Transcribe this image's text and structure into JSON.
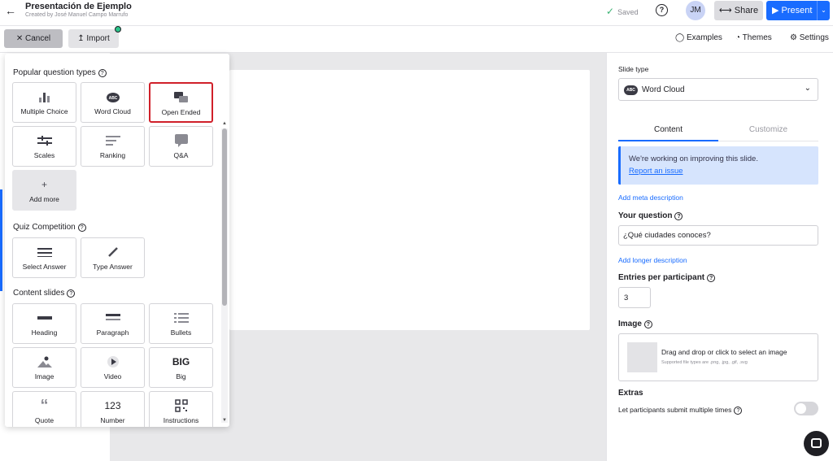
{
  "header": {
    "back_icon": "arrow-left-icon",
    "title": "Presentación de Ejemplo",
    "subtitle": "Created by José Manuel Campo Marrufo",
    "saved_label": "Saved",
    "avatar_initials": "JM",
    "share_label": "Share",
    "present_label": "Present"
  },
  "toolbar": {
    "cancel_label": "Cancel",
    "import_label": "Import",
    "examples_label": "Examples",
    "themes_label": "Themes",
    "settings_label": "Settings"
  },
  "panel": {
    "popular_title": "Popular question types",
    "popular": [
      {
        "label": "Multiple Choice",
        "icon": "bar-chart-icon"
      },
      {
        "label": "Word Cloud",
        "icon": "word-cloud-icon"
      },
      {
        "label": "Open Ended",
        "icon": "speech-bubbles-icon"
      },
      {
        "label": "Scales",
        "icon": "sliders-icon"
      },
      {
        "label": "Ranking",
        "icon": "ranking-icon"
      },
      {
        "label": "Q&A",
        "icon": "qa-bubble-icon"
      },
      {
        "label": "Add more",
        "icon": "plus-icon"
      }
    ],
    "quiz_title": "Quiz Competition",
    "quiz": [
      {
        "label": "Select Answer",
        "icon": "list-lines-icon"
      },
      {
        "label": "Type Answer",
        "icon": "pencil-icon"
      }
    ],
    "content_title": "Content slides",
    "content": [
      {
        "label": "Heading",
        "icon": "heading-icon"
      },
      {
        "label": "Paragraph",
        "icon": "paragraph-icon"
      },
      {
        "label": "Bullets",
        "icon": "bullets-icon"
      },
      {
        "label": "Image",
        "icon": "image-icon"
      },
      {
        "label": "Video",
        "icon": "play-icon"
      },
      {
        "label": "Big",
        "icon": "big-text-icon",
        "glyph": "BIG"
      },
      {
        "label": "Quote",
        "icon": "quote-icon"
      },
      {
        "label": "Number",
        "icon": "number-icon",
        "glyph": "123"
      },
      {
        "label": "Instructions",
        "icon": "qr-code-icon"
      }
    ]
  },
  "right": {
    "slide_type_label": "Slide type",
    "slide_type_value": "Word Cloud",
    "slide_type_icon_text": "ABC",
    "tab_content": "Content",
    "tab_customize": "Customize",
    "notice_text": "We're working on improving this slide.",
    "notice_link": "Report an issue",
    "meta_link": "Add meta description",
    "question_label": "Your question",
    "question_value": "¿Qué ciudades conoces?",
    "longer_link": "Add longer description",
    "entries_label": "Entries per participant",
    "entries_value": "3",
    "image_label": "Image",
    "drop_text": "Drag and drop or click to select an image",
    "drop_sub": "Supported file types are .png, .jpg, .gif, .svg",
    "extras_label": "Extras",
    "multiple_label": "Let participants submit multiple times",
    "multiple_enabled": false
  },
  "colors": {
    "accent": "#196cff",
    "highlight": "#d0202a",
    "saved_check": "#3bb273"
  }
}
